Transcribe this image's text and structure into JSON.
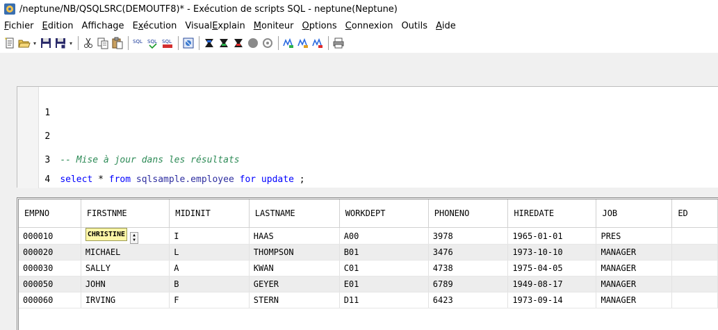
{
  "window": {
    "title": "/neptune/NB/QSQLSRC(DEMOUTF8)* - Exécution de scripts SQL - neptune(Neptune)"
  },
  "menu": {
    "items": [
      {
        "label": "Fichier",
        "accel": "F"
      },
      {
        "label": "Edition",
        "accel": "E"
      },
      {
        "label": "Affichage",
        "accel": "i"
      },
      {
        "label": "Exécution",
        "accel": "x"
      },
      {
        "label": "VisualExplain",
        "accel": "E"
      },
      {
        "label": "Moniteur",
        "accel": "M"
      },
      {
        "label": "Options",
        "accel": "O"
      },
      {
        "label": "Connexion",
        "accel": "C"
      },
      {
        "label": "Outils",
        "accel": ""
      },
      {
        "label": "Aide",
        "accel": "A"
      }
    ]
  },
  "toolbar": {
    "icons": [
      "new-script-icon",
      "open-folder-icon",
      "save-icon",
      "save-as-icon",
      "cut-icon",
      "copy-icon",
      "paste-icon",
      "run-sql-icon",
      "run-sql-step-icon",
      "run-sql-all-icon",
      "results-icon",
      "explain-icon",
      "explain-step-icon",
      "explain-all-icon",
      "stop-icon",
      "cancel-icon",
      "monitor-icon",
      "monitor-step-icon",
      "monitor-all-icon",
      "print-icon"
    ],
    "sql_label": "SQL"
  },
  "editor": {
    "lines": [
      {
        "num": "1"
      },
      {
        "num": "2"
      },
      {
        "num": "3",
        "comment": "-- Mise à jour dans les résultats"
      },
      {
        "num": "4",
        "kw1": "select",
        "t1": " * ",
        "kw2": "from",
        "t2": " ",
        "table": "sqlsample.employee",
        "t3": " ",
        "kw3": "for update",
        "t4": " ;"
      }
    ]
  },
  "grid": {
    "columns": [
      "EMPNO",
      "FIRSTNME",
      "MIDINIT",
      "LASTNAME",
      "WORKDEPT",
      "PHONENO",
      "HIREDATE",
      "JOB",
      "ED"
    ],
    "rows": [
      [
        "000010",
        "CHRISTINE",
        "I",
        "HAAS",
        "A00",
        "3978",
        "1965-01-01",
        "PRES",
        ""
      ],
      [
        "000020",
        "MICHAEL",
        "L",
        "THOMPSON",
        "B01",
        "3476",
        "1973-10-10",
        "MANAGER",
        ""
      ],
      [
        "000030",
        "SALLY",
        "A",
        "KWAN",
        "C01",
        "4738",
        "1975-04-05",
        "MANAGER",
        ""
      ],
      [
        "000050",
        "JOHN",
        "B",
        "GEYER",
        "E01",
        "6789",
        "1949-08-17",
        "MANAGER",
        ""
      ],
      [
        "000060",
        "IRVING",
        "F",
        "STERN",
        "D11",
        "6423",
        "1973-09-14",
        "MANAGER",
        ""
      ]
    ]
  }
}
